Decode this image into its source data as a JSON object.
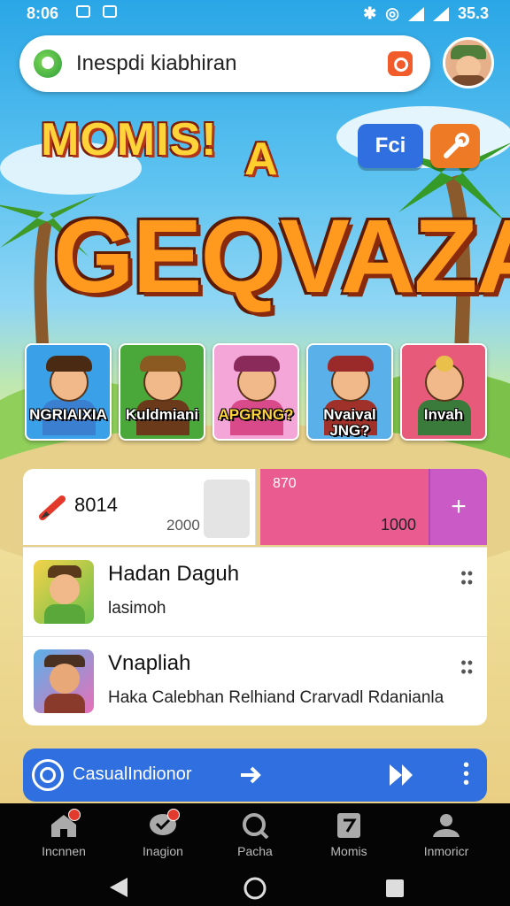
{
  "status_bar": {
    "time": "8:06",
    "battery": "35.3"
  },
  "search": {
    "query": "Inespdi kiabhiran"
  },
  "top_buttons": {
    "blue_label": "Fci",
    "orange_icon": "wrench-icon"
  },
  "logo": {
    "line1": "MOMIS!",
    "line2": "A",
    "title": "GEQVAZA"
  },
  "characters": [
    {
      "name": "NGRIAIXIA",
      "color": "#3aa0e8"
    },
    {
      "name": "Kuldmiani",
      "color": "#4aa83a"
    },
    {
      "name": "APGRNG?",
      "color": "#f4a6d8"
    },
    {
      "name": "Nvaival JNG?",
      "color": "#5ab0e8"
    },
    {
      "name": "Invah",
      "color": "#e85a7a"
    }
  ],
  "resources": {
    "left_value": "8014",
    "left_sub": "2000",
    "right_top": "870",
    "right_bottom": "1000",
    "plus": "+"
  },
  "list": [
    {
      "title": "Hadan Daguh",
      "sub": "lasimoh"
    },
    {
      "title": "Vnapliah",
      "sub": "Haka Calebhan Relhiand Crarvadl Rdanianla"
    }
  ],
  "bottom_action": {
    "label": "CasualIndionor"
  },
  "nav": [
    {
      "label": "Incnnen",
      "icon": "home-icon",
      "badge": true
    },
    {
      "label": "Inagion",
      "icon": "chat-icon",
      "badge": true
    },
    {
      "label": "Pacha",
      "icon": "search-icon",
      "badge": false
    },
    {
      "label": "Momis",
      "icon": "cards-icon",
      "badge": false
    },
    {
      "label": "Inmoricr",
      "icon": "profile-icon",
      "badge": false
    }
  ],
  "colors": {
    "accent_blue": "#2f6fe0",
    "pink": "#ea5c8f",
    "purple": "#c95ac6",
    "orange": "#ef7a26"
  }
}
